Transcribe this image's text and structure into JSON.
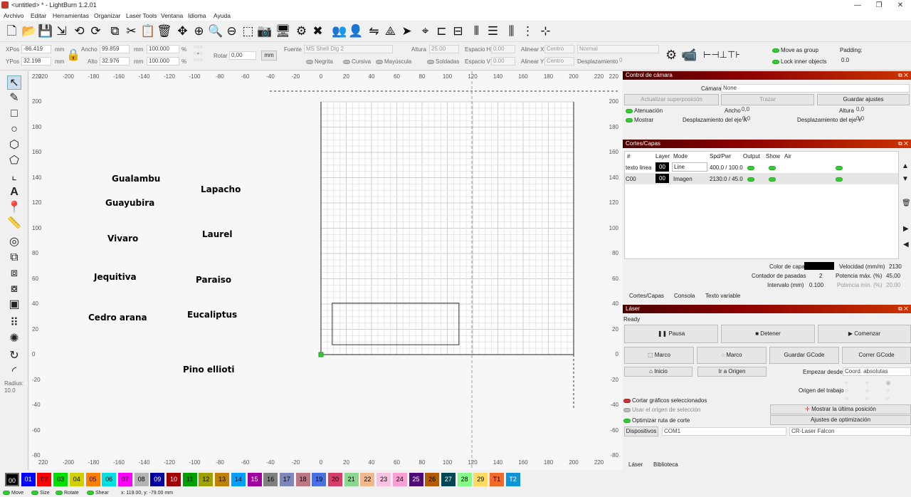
{
  "window": {
    "title": "<untitled> * - LightBurn 1.2.01"
  },
  "menu": [
    "Archivo",
    "Editar",
    "Herramientas",
    "Organizar",
    "Laser Tools",
    "Ventana",
    "Idioma",
    "Ayuda"
  ],
  "props": {
    "xpos_label": "XPos",
    "xpos": "-86.419",
    "ypos_label": "YPos",
    "ypos": "32.198",
    "unit": "mm",
    "ancho_label": "Ancho",
    "ancho": "99.859",
    "alto_label": "Alto",
    "alto": "32.976",
    "pct1": "100.000",
    "pct2": "100.000",
    "pct_unit": "%",
    "rotar_label": "Rotar",
    "rotar": "0,00",
    "mm_btn": "mm",
    "fuente_label": "Fuente",
    "fuente": "MS Shell Dlg 2",
    "altura_label": "Altura",
    "altura": "25.00",
    "espacio_h_label": "Espacio H",
    "espacio_h": "0.00",
    "espacio_v_label": "Espacio V",
    "espacio_v": "0.00",
    "alinear_x_label": "Alinear X",
    "alinear_x": "Centro",
    "alinear_y_label": "Alinear Y",
    "alinear_y": "Centro",
    "normal": "Normal",
    "despl_label": "Desplazamiento",
    "despl": "0",
    "negrita": "Negrita",
    "cursiva": "Cursiva",
    "mayuscula": "Mayúscula",
    "soldadas": "Soldadas",
    "move_group": "Move as group",
    "lock_inner": "Lock inner objects",
    "padding_label": "Padding:",
    "padding": "0.0"
  },
  "ruler": {
    "top": [
      "220",
      "-200",
      "-180",
      "-160",
      "-140",
      "-120",
      "-100",
      "-80",
      "-60",
      "-40",
      "-20",
      "0",
      "20",
      "40",
      "60",
      "80",
      "100",
      "120",
      "140",
      "160",
      "180",
      "200",
      "220"
    ],
    "left": [
      "220",
      "200",
      "180",
      "160",
      "140",
      "120",
      "100",
      "80",
      "60",
      "40",
      "20",
      "0",
      "-20",
      "-40",
      "-60",
      "-80"
    ]
  },
  "canvas_labels": [
    "Gualambu",
    "Lapacho",
    "Guayubira",
    "Vivaro",
    "Laurel",
    "Jequitiva",
    "Paraiso",
    "Cedro arana",
    "Eucaliptus",
    "Pino ellioti"
  ],
  "left_tools": {
    "radius_label": "Radius:",
    "radius": "10.0"
  },
  "camera": {
    "title": "Control de cámara",
    "camara_label": "Cámara:",
    "camara": "None",
    "actualizar": "Actualizar superposición",
    "trazar": "Trazar",
    "guardar": "Guardar ajustes",
    "atenuacion": "Atenuación",
    "ancho_label": "Ancho",
    "ancho": "0,0",
    "altura_label": "Altura",
    "altura": "0,0",
    "mostrar": "Mostrar",
    "despx_label": "Desplazamiento del eje X",
    "despx": "0,0",
    "despy_label": "Desplazamiento del eje Y",
    "despy": "0,0"
  },
  "cuts": {
    "title": "Cortes/Capas",
    "headers": [
      "#",
      "Layer",
      "Mode",
      "Spd/Pwr",
      "Output",
      "Show",
      "Air"
    ],
    "rows": [
      {
        "name": "texto linea",
        "layer": "00",
        "mode": "Line",
        "spd": "400.0 / 100.0",
        "color": "#000000"
      },
      {
        "name": "C00",
        "layer": "00",
        "mode": "Imagen",
        "spd": "2130.0 / 45.0",
        "color": "#000000"
      }
    ],
    "color_capa_label": "Color de capa",
    "velocidad_label": "Velocidad (mm/m)",
    "velocidad": "2130",
    "pasadas_label": "Contador de pasadas",
    "pasadas": "2",
    "pot_max_label": "Potencia máx. (%)",
    "pot_max": "45,00",
    "intervalo_label": "Intervalo (mm)",
    "intervalo": "0.100",
    "pot_min_label": "Potencia mín. (%)",
    "pot_min": "20,00",
    "tabs": [
      "Cortes/Capas",
      "Consola",
      "Texto variable"
    ]
  },
  "laser": {
    "title": "Láser",
    "status": "Ready",
    "pausa": "Pausa",
    "detener": "Detener",
    "comenzar": "Comenzar",
    "marco1": "Marco",
    "marco2": "Marco",
    "guardar_gcode": "Guardar GCode",
    "correr_gcode": "Correr GCode",
    "inicio": "Inicio",
    "ir_origen": "Ir a Origen",
    "empezar_label": "Empezar desde:",
    "empezar": "Coord. absolutas",
    "origen_label": "Origen del trabajo",
    "cortar_sel": "Cortar gráficos seleccionados",
    "usar_origen": "Usar el origen de selección",
    "mostrar_ultima": "Mostrar la última posición",
    "optimizar_ruta": "Optimizar ruta de corte",
    "ajustes_opt": "Ajustes de optimización",
    "dispositivos": "Dispositivos",
    "com": "COM1",
    "device": "CR-Laser Falcon",
    "tabs": [
      "Láser",
      "Biblioteca"
    ]
  },
  "palette": [
    {
      "label": "00",
      "color": "#000000",
      "fg": "#ffffff"
    },
    {
      "label": "01",
      "color": "#0000ff",
      "fg": "#ffffff"
    },
    {
      "label": "02",
      "color": "#ff0000",
      "fg": "#000000"
    },
    {
      "label": "03",
      "color": "#00e000",
      "fg": "#000000"
    },
    {
      "label": "04",
      "color": "#d0d000",
      "fg": "#000000"
    },
    {
      "label": "05",
      "color": "#ff8000",
      "fg": "#000000"
    },
    {
      "label": "06",
      "color": "#00e0e0",
      "fg": "#000000"
    },
    {
      "label": "07",
      "color": "#ff00ff",
      "fg": "#000000"
    },
    {
      "label": "08",
      "color": "#b4b4b4",
      "fg": "#000000"
    },
    {
      "label": "09",
      "color": "#0000a0",
      "fg": "#ffffff"
    },
    {
      "label": "10",
      "color": "#a00000",
      "fg": "#ffffff"
    },
    {
      "label": "11",
      "color": "#00a000",
      "fg": "#000000"
    },
    {
      "label": "12",
      "color": "#a0a000",
      "fg": "#000000"
    },
    {
      "label": "13",
      "color": "#c08000",
      "fg": "#000000"
    },
    {
      "label": "14",
      "color": "#00a0ff",
      "fg": "#000000"
    },
    {
      "label": "15",
      "color": "#a000a0",
      "fg": "#ffffff"
    },
    {
      "label": "16",
      "color": "#808080",
      "fg": "#000000"
    },
    {
      "label": "17",
      "color": "#7d87b9",
      "fg": "#000000"
    },
    {
      "label": "18",
      "color": "#bb7784",
      "fg": "#000000"
    },
    {
      "label": "19",
      "color": "#4a6fe3",
      "fg": "#000000"
    },
    {
      "label": "20",
      "color": "#d33f6a",
      "fg": "#000000"
    },
    {
      "label": "21",
      "color": "#8cd78f",
      "fg": "#000000"
    },
    {
      "label": "22",
      "color": "#f0b98d",
      "fg": "#000000"
    },
    {
      "label": "23",
      "color": "#f6c4e1",
      "fg": "#000000"
    },
    {
      "label": "24",
      "color": "#fa9ed4",
      "fg": "#000000"
    },
    {
      "label": "25",
      "color": "#500a78",
      "fg": "#ffffff"
    },
    {
      "label": "26",
      "color": "#b45a00",
      "fg": "#000000"
    },
    {
      "label": "27",
      "color": "#004754",
      "fg": "#ffffff"
    },
    {
      "label": "28",
      "color": "#86fa88",
      "fg": "#000000"
    },
    {
      "label": "29",
      "color": "#ffdb66",
      "fg": "#000000"
    },
    {
      "label": "T1",
      "color": "#f36926",
      "fg": "#000000"
    },
    {
      "label": "T2",
      "color": "#0c96d9",
      "fg": "#ffffff"
    }
  ],
  "status": {
    "move": "Move",
    "size": "Size",
    "rotate": "Rotate",
    "shear": "Shear",
    "coords": "x: 119.00, y: -79.00 mm"
  }
}
